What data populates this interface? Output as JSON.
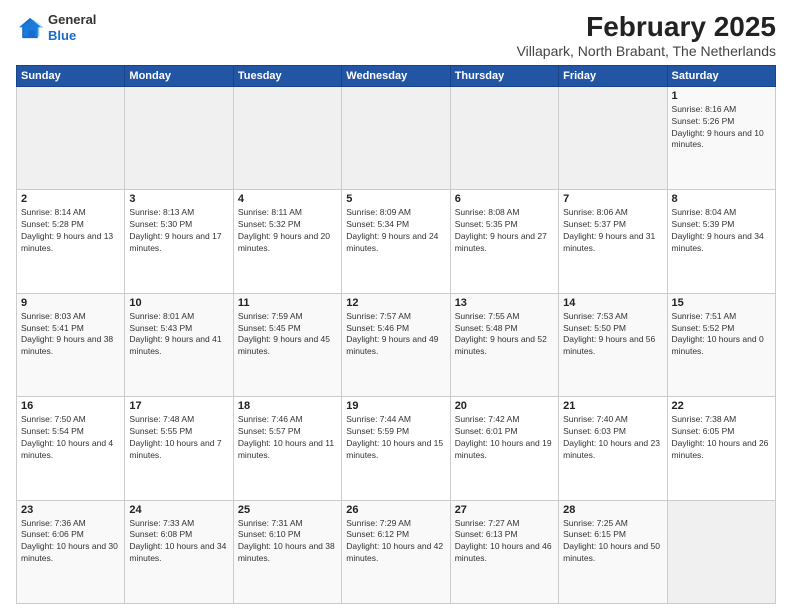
{
  "logo": {
    "general": "General",
    "blue": "Blue"
  },
  "header": {
    "month": "February 2025",
    "location": "Villapark, North Brabant, The Netherlands"
  },
  "weekdays": [
    "Sunday",
    "Monday",
    "Tuesday",
    "Wednesday",
    "Thursday",
    "Friday",
    "Saturday"
  ],
  "weeks": [
    [
      {
        "day": "",
        "info": ""
      },
      {
        "day": "",
        "info": ""
      },
      {
        "day": "",
        "info": ""
      },
      {
        "day": "",
        "info": ""
      },
      {
        "day": "",
        "info": ""
      },
      {
        "day": "",
        "info": ""
      },
      {
        "day": "1",
        "info": "Sunrise: 8:16 AM\nSunset: 5:26 PM\nDaylight: 9 hours and 10 minutes."
      }
    ],
    [
      {
        "day": "2",
        "info": "Sunrise: 8:14 AM\nSunset: 5:28 PM\nDaylight: 9 hours and 13 minutes."
      },
      {
        "day": "3",
        "info": "Sunrise: 8:13 AM\nSunset: 5:30 PM\nDaylight: 9 hours and 17 minutes."
      },
      {
        "day": "4",
        "info": "Sunrise: 8:11 AM\nSunset: 5:32 PM\nDaylight: 9 hours and 20 minutes."
      },
      {
        "day": "5",
        "info": "Sunrise: 8:09 AM\nSunset: 5:34 PM\nDaylight: 9 hours and 24 minutes."
      },
      {
        "day": "6",
        "info": "Sunrise: 8:08 AM\nSunset: 5:35 PM\nDaylight: 9 hours and 27 minutes."
      },
      {
        "day": "7",
        "info": "Sunrise: 8:06 AM\nSunset: 5:37 PM\nDaylight: 9 hours and 31 minutes."
      },
      {
        "day": "8",
        "info": "Sunrise: 8:04 AM\nSunset: 5:39 PM\nDaylight: 9 hours and 34 minutes."
      }
    ],
    [
      {
        "day": "9",
        "info": "Sunrise: 8:03 AM\nSunset: 5:41 PM\nDaylight: 9 hours and 38 minutes."
      },
      {
        "day": "10",
        "info": "Sunrise: 8:01 AM\nSunset: 5:43 PM\nDaylight: 9 hours and 41 minutes."
      },
      {
        "day": "11",
        "info": "Sunrise: 7:59 AM\nSunset: 5:45 PM\nDaylight: 9 hours and 45 minutes."
      },
      {
        "day": "12",
        "info": "Sunrise: 7:57 AM\nSunset: 5:46 PM\nDaylight: 9 hours and 49 minutes."
      },
      {
        "day": "13",
        "info": "Sunrise: 7:55 AM\nSunset: 5:48 PM\nDaylight: 9 hours and 52 minutes."
      },
      {
        "day": "14",
        "info": "Sunrise: 7:53 AM\nSunset: 5:50 PM\nDaylight: 9 hours and 56 minutes."
      },
      {
        "day": "15",
        "info": "Sunrise: 7:51 AM\nSunset: 5:52 PM\nDaylight: 10 hours and 0 minutes."
      }
    ],
    [
      {
        "day": "16",
        "info": "Sunrise: 7:50 AM\nSunset: 5:54 PM\nDaylight: 10 hours and 4 minutes."
      },
      {
        "day": "17",
        "info": "Sunrise: 7:48 AM\nSunset: 5:55 PM\nDaylight: 10 hours and 7 minutes."
      },
      {
        "day": "18",
        "info": "Sunrise: 7:46 AM\nSunset: 5:57 PM\nDaylight: 10 hours and 11 minutes."
      },
      {
        "day": "19",
        "info": "Sunrise: 7:44 AM\nSunset: 5:59 PM\nDaylight: 10 hours and 15 minutes."
      },
      {
        "day": "20",
        "info": "Sunrise: 7:42 AM\nSunset: 6:01 PM\nDaylight: 10 hours and 19 minutes."
      },
      {
        "day": "21",
        "info": "Sunrise: 7:40 AM\nSunset: 6:03 PM\nDaylight: 10 hours and 23 minutes."
      },
      {
        "day": "22",
        "info": "Sunrise: 7:38 AM\nSunset: 6:05 PM\nDaylight: 10 hours and 26 minutes."
      }
    ],
    [
      {
        "day": "23",
        "info": "Sunrise: 7:36 AM\nSunset: 6:06 PM\nDaylight: 10 hours and 30 minutes."
      },
      {
        "day": "24",
        "info": "Sunrise: 7:33 AM\nSunset: 6:08 PM\nDaylight: 10 hours and 34 minutes."
      },
      {
        "day": "25",
        "info": "Sunrise: 7:31 AM\nSunset: 6:10 PM\nDaylight: 10 hours and 38 minutes."
      },
      {
        "day": "26",
        "info": "Sunrise: 7:29 AM\nSunset: 6:12 PM\nDaylight: 10 hours and 42 minutes."
      },
      {
        "day": "27",
        "info": "Sunrise: 7:27 AM\nSunset: 6:13 PM\nDaylight: 10 hours and 46 minutes."
      },
      {
        "day": "28",
        "info": "Sunrise: 7:25 AM\nSunset: 6:15 PM\nDaylight: 10 hours and 50 minutes."
      },
      {
        "day": "",
        "info": ""
      }
    ]
  ]
}
